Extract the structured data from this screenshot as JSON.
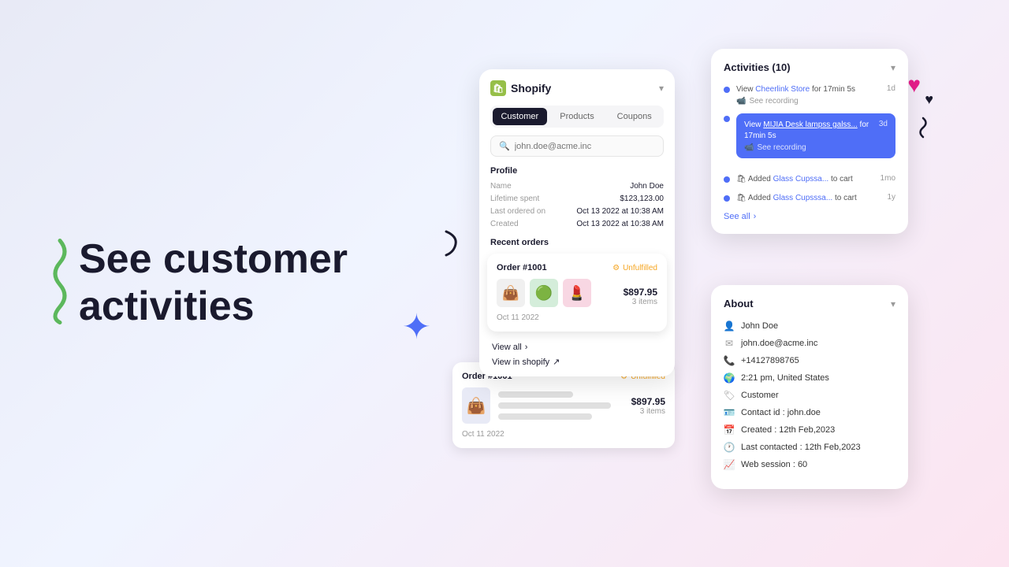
{
  "hero": {
    "title_line1": "See customer",
    "title_line2": "activities"
  },
  "shopify_card": {
    "logo_text": "Shopify",
    "tabs": [
      "Customer",
      "Products",
      "Coupons"
    ],
    "active_tab": "Customer",
    "search_placeholder": "john.doe@acme.inc",
    "profile": {
      "section_title": "Profile",
      "fields": [
        {
          "label": "Name",
          "value": "John Doe"
        },
        {
          "label": "Lifetime spent",
          "value": "$123,123.00"
        },
        {
          "label": "Last ordered on",
          "value": "Oct 13 2022 at 10:38 AM"
        },
        {
          "label": "Created",
          "value": "Oct 13 2022 at 10:38 AM"
        }
      ]
    },
    "recent_orders_title": "Recent orders",
    "order_front": {
      "id": "Order #1001",
      "status": "Unfulfilled",
      "price": "$897.95",
      "items": "3 items",
      "date": "Oct 11 2022",
      "images": [
        "👜",
        "🟢",
        "💄"
      ]
    },
    "order_back": {
      "id": "Order #1001",
      "status": "Unfulfilled",
      "price": "$897.95",
      "items": "3 items",
      "date": "Oct 11 2022"
    },
    "view_all": "View all",
    "view_in_shopify": "View in shopify"
  },
  "activities": {
    "title": "Activities (10)",
    "items": [
      {
        "text": "View",
        "link": "Cheerlink Store",
        "suffix": "for 17min 5s",
        "sub": "See recording",
        "time": "1d",
        "highlighted": false
      },
      {
        "text": "View",
        "link": "MIJIA Desk lampss galss...",
        "suffix": "for 17min 5s",
        "sub": "See recording",
        "time": "3d",
        "highlighted": true
      },
      {
        "text": "Added",
        "link": "Glass Cupssa...",
        "suffix": "to cart",
        "time": "1mo",
        "highlighted": false
      },
      {
        "text": "Added",
        "link": "Glass Cupsssa...",
        "suffix": "to cart",
        "time": "1y",
        "highlighted": false
      }
    ],
    "see_all": "See all"
  },
  "about": {
    "title": "About",
    "rows": [
      {
        "icon": "person",
        "text": "John Doe"
      },
      {
        "icon": "email",
        "text": "john.doe@acme.inc"
      },
      {
        "icon": "phone",
        "text": "+14127898765"
      },
      {
        "icon": "location",
        "text": "2:21 pm, United States"
      },
      {
        "icon": "tag",
        "text": "Customer"
      },
      {
        "icon": "id",
        "text": "Contact id : john.doe"
      },
      {
        "icon": "calendar",
        "text": "Created : 12th Feb,2023"
      },
      {
        "icon": "clock",
        "text": "Last contacted : 12th Feb,2023"
      },
      {
        "icon": "chart",
        "text": "Web session : 60"
      }
    ]
  }
}
